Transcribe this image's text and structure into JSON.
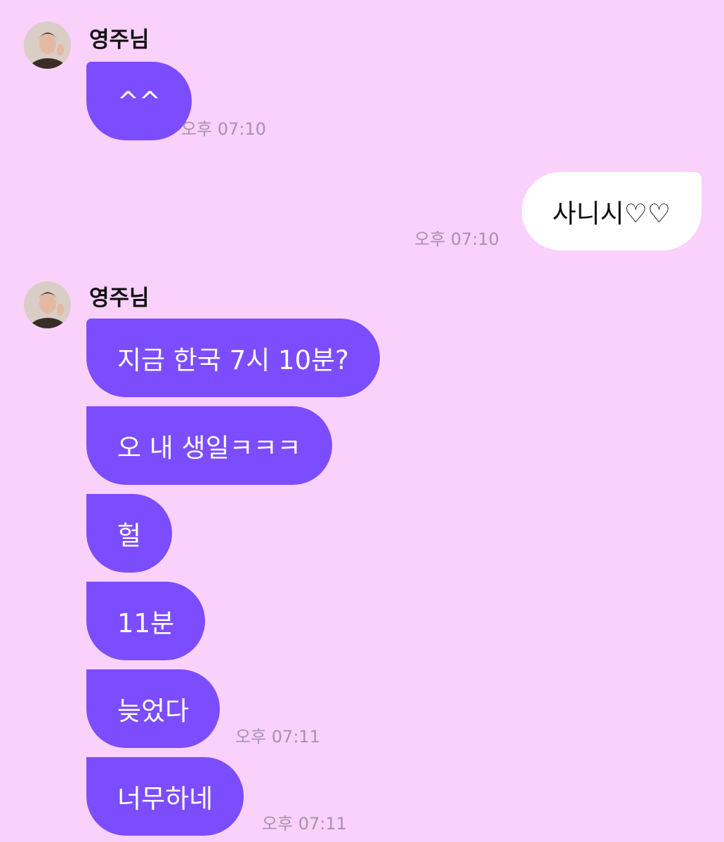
{
  "colors": {
    "background": "#f9d1fb",
    "incoming_bubble": "#7c4dff",
    "outgoing_bubble": "#ffffff",
    "timestamp": "#a991ad"
  },
  "groups": [
    {
      "sender": "영주님",
      "messages": [
        {
          "text": "^^",
          "time": "오후 07:10"
        }
      ]
    },
    {
      "sender": "me",
      "messages": [
        {
          "text": "사니시♡♡",
          "time": "오후 07:10"
        }
      ]
    },
    {
      "sender": "영주님",
      "messages": [
        {
          "text": "지금 한국 7시 10분?",
          "time": ""
        },
        {
          "text": "오 내 생일ㅋㅋㅋ",
          "time": ""
        },
        {
          "text": "헐",
          "time": ""
        },
        {
          "text": "11분",
          "time": ""
        },
        {
          "text": "늦었다",
          "time": "오후 07:11"
        },
        {
          "text": "너무하네",
          "time": "오후 07:11"
        }
      ]
    }
  ]
}
